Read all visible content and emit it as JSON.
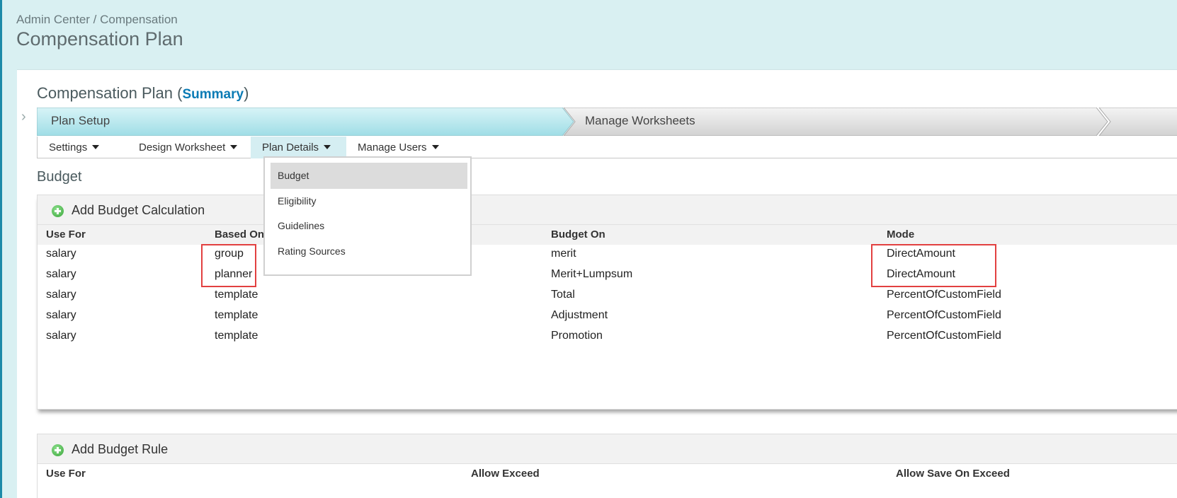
{
  "breadcrumb": {
    "admin_center": "Admin Center",
    "separator": " / ",
    "compensation": "Compensation"
  },
  "page_title": "Compensation Plan",
  "section": {
    "title": "Compensation Plan",
    "open_paren": "(",
    "summary_link": "Summary",
    "close_paren": ")"
  },
  "steps": [
    {
      "label": "Plan Setup",
      "active": true
    },
    {
      "label": "Manage Worksheets",
      "active": false
    }
  ],
  "subnav": [
    {
      "label": "Settings"
    },
    {
      "label": "Design Worksheet"
    },
    {
      "label": "Plan Details",
      "active": true
    },
    {
      "label": "Manage Users"
    }
  ],
  "dropdown": {
    "items": [
      "Budget",
      "Eligibility",
      "Guidelines",
      "Rating Sources"
    ],
    "selected": "Budget"
  },
  "budget_heading": "Budget",
  "budget_calc": {
    "add_label": "Add Budget Calculation",
    "columns": [
      "Use For",
      "Based On",
      "Budget On",
      "Mode"
    ],
    "rows": [
      [
        "salary",
        "group",
        "merit",
        "DirectAmount"
      ],
      [
        "salary",
        "planner",
        "Merit+Lumpsum",
        "DirectAmount"
      ],
      [
        "salary",
        "template",
        "Total",
        "PercentOfCustomField"
      ],
      [
        "salary",
        "template",
        "Adjustment",
        "PercentOfCustomField"
      ],
      [
        "salary",
        "template",
        "Promotion",
        "PercentOfCustomField"
      ]
    ]
  },
  "budget_rule": {
    "add_label": "Add Budget Rule",
    "columns": [
      "Use For",
      "Allow Exceed",
      "Allow Save On Exceed"
    ]
  },
  "colors": {
    "header_bg": "#d9f0f2",
    "active_step": "#b9e6ec",
    "link": "#0a7bb5",
    "highlight": "#e24040"
  }
}
